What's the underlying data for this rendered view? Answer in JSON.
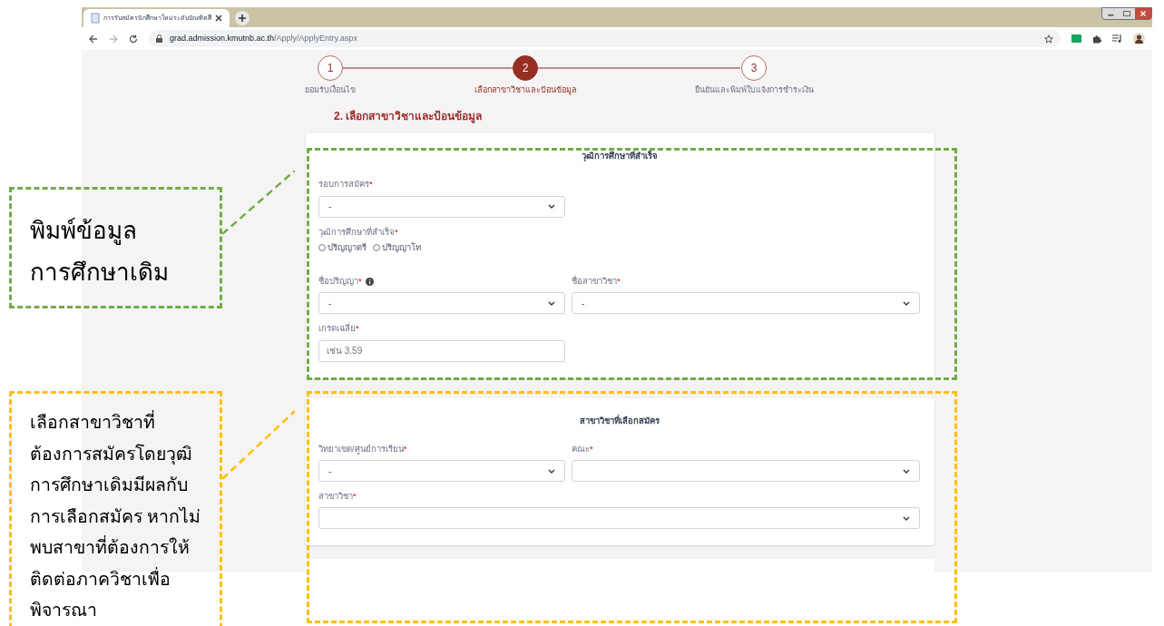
{
  "browser": {
    "tab_title": "การรับสมัครนักศึกษาใหม่ระดับบัณฑิตศึ",
    "url_host": "grad.admission.kmutnb.ac.th",
    "url_path": "/Apply/ApplyEntry.aspx"
  },
  "stepper": {
    "steps": [
      {
        "number": "1",
        "label": "ยอมรับเงื่อนไข",
        "selected": false
      },
      {
        "number": "2",
        "label": "เลือกสาขาวิชาและป้อนข้อมูล",
        "selected": true
      },
      {
        "number": "3",
        "label": "ยืนยันและพิมพ์ใบแจ้งการชำระเงิน",
        "selected": false
      }
    ]
  },
  "section_title": "2. เลือกสาขาวิชาและป้อนข้อมูล",
  "cards": [
    {
      "title": "วุฒิการศึกษาที่สำเร็จ",
      "rows": [
        [
          {
            "kind": "select",
            "label": "รอบการสมัคร",
            "required_mark": "*",
            "value": "-"
          }
        ],
        [
          {
            "kind": "radio",
            "label": "วุฒิการศึกษาที่สำเร็จ",
            "required_mark": "*",
            "options": [
              {
                "label": "ปริญญาตรี",
                "selected": false
              },
              {
                "label": "ปริญญาโท",
                "selected": false
              }
            ]
          }
        ],
        [
          {
            "kind": "select",
            "label": "ชื่อปริญญา",
            "required_mark": "*",
            "info": true,
            "value": "-"
          },
          {
            "kind": "select",
            "label": "ชื่อสาขาวิชา",
            "required_mark": "*",
            "value": "-"
          }
        ],
        [
          {
            "kind": "text",
            "label": "เกรดเฉลี่ย",
            "required_mark": "*",
            "placeholder": "เช่น 3.59"
          }
        ]
      ]
    },
    {
      "title": "สาขาวิชาที่เลือกสมัคร",
      "rows": [
        [
          {
            "kind": "select",
            "label": "วิทยาเขต/ศูนย์การเรียน",
            "required_mark": "*",
            "value": "-"
          },
          {
            "kind": "select",
            "label": "คณะ",
            "required_mark": "*"
          }
        ],
        [
          {
            "kind": "select",
            "label": "สาขาวิชา",
            "required_mark": "*",
            "full": true
          }
        ]
      ]
    }
  ],
  "annotations": [
    {
      "color": "#70ad47",
      "lines": [
        "พิมพ์ข้อมูล",
        "การศึกษาเดิม"
      ]
    },
    {
      "color": "#ffc000",
      "lines": [
        "เลือกสาขาวิชาที่",
        "ต้องการสมัครโดยวุฒิ",
        "การศึกษาเดิมมีผลกับ",
        "การเลือกสมัคร หากไม่",
        "พบสาขาที่ต้องการให้",
        "ติดต่อภาควิชาเพื่อ",
        "พิจารณา"
      ]
    }
  ]
}
